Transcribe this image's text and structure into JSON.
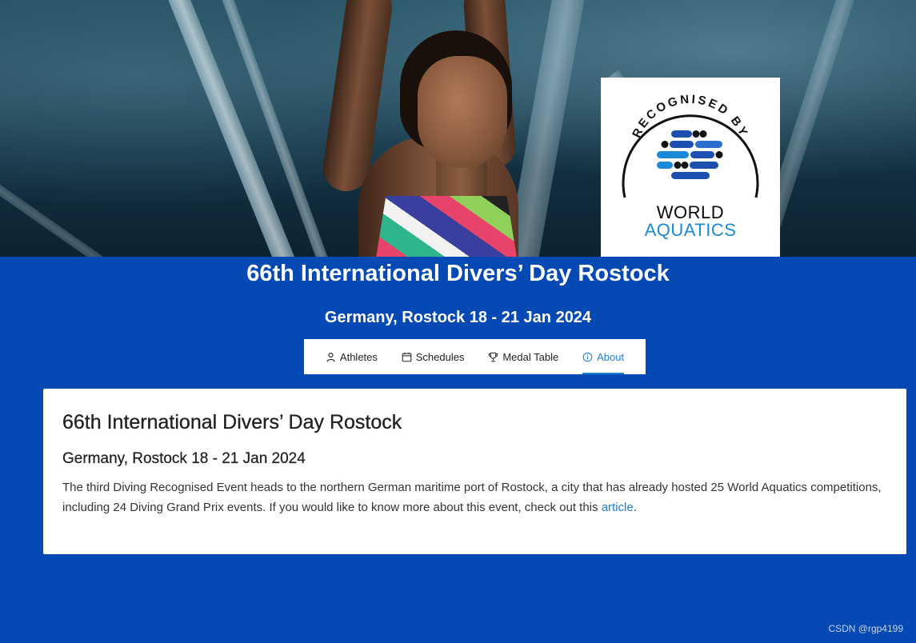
{
  "hero": {
    "logo": {
      "arc_text": "RECOGNISED BY",
      "line1": "WORLD",
      "line2": "AQUATICS",
      "colors": {
        "blue_light": "#1a8ad8",
        "blue_dark": "#1d4fb0",
        "black": "#111111"
      }
    }
  },
  "event": {
    "title": "66th International Divers’ Day Rostock",
    "subtitle": "Germany, Rostock 18 - 21 Jan 2024"
  },
  "tabs": [
    {
      "label": "Athletes",
      "icon": "person-icon",
      "active": false
    },
    {
      "label": "Schedules",
      "icon": "calendar-icon",
      "active": false
    },
    {
      "label": "Medal Table",
      "icon": "trophy-icon",
      "active": false
    },
    {
      "label": "About",
      "icon": "info-icon",
      "active": true
    }
  ],
  "about": {
    "title": "66th International Divers’ Day Rostock",
    "subtitle": "Germany, Rostock 18 - 21 Jan 2024",
    "body_text": "The third Diving Recognised Event heads to the northern German maritime port of Rostock, a city that has already hosted 25 World Aquatics competitions, including 24 Diving Grand Prix events. If you would like to know more about this event, check out this ",
    "link_text": "article",
    "body_end": "."
  },
  "watermark": "CSDN @rgp4199",
  "colors": {
    "page_bg": "#0449b4",
    "accent": "#1e7fd6"
  }
}
